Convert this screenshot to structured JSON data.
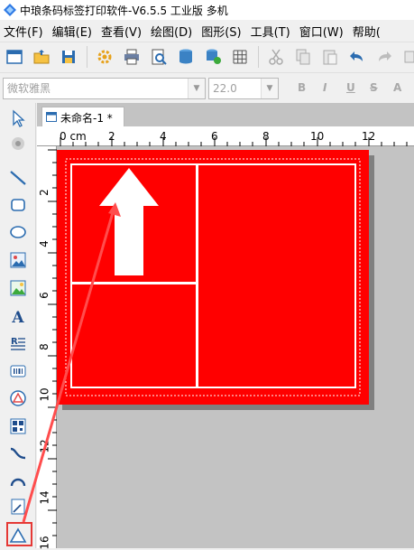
{
  "window": {
    "title": "中琅条码标签打印软件-V6.5.5 工业版 多机"
  },
  "menu": {
    "items": [
      {
        "name": "menu-file",
        "label": "文件(F)"
      },
      {
        "name": "menu-edit",
        "label": "编辑(E)"
      },
      {
        "name": "menu-view",
        "label": "查看(V)"
      },
      {
        "name": "menu-draw",
        "label": "绘图(D)"
      },
      {
        "name": "menu-graphics",
        "label": "图形(S)"
      },
      {
        "name": "menu-tools",
        "label": "工具(T)"
      },
      {
        "name": "menu-window",
        "label": "窗口(W)"
      },
      {
        "name": "menu-help",
        "label": "帮助("
      }
    ]
  },
  "fontbar": {
    "font_name": "微软雅黑",
    "font_size": "22.0",
    "bold": "B",
    "italic": "I",
    "underline": "U",
    "strike": "S",
    "more": "A"
  },
  "document": {
    "tab_label": "未命名-1 *"
  },
  "ruler": {
    "top": [
      "0 cm",
      "2",
      "4",
      "6",
      "8",
      "10",
      "12"
    ],
    "left": [
      "2",
      "4",
      "6",
      "8",
      "10",
      "12",
      "14",
      "16"
    ]
  },
  "colors": {
    "label_fill": "#ff0000",
    "highlight": "#e53935"
  }
}
